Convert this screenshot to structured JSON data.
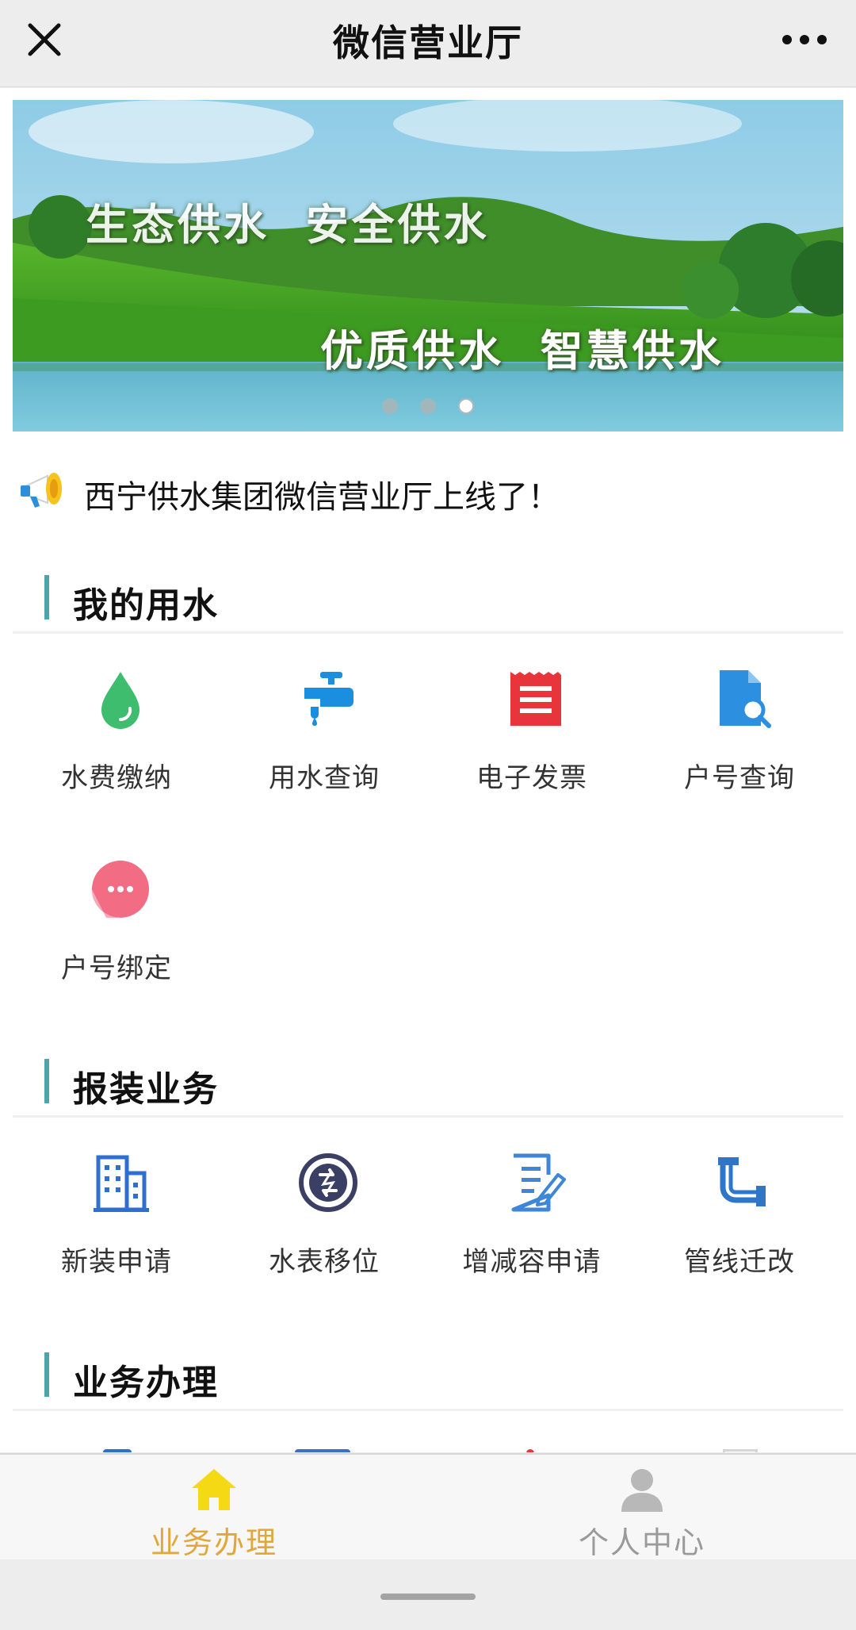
{
  "window": {
    "title": "微信营业厅"
  },
  "banner": {
    "caption_line1": "生态供水  安全供水",
    "caption_line2": "优质供水  智慧供水",
    "slide_count": 3,
    "active_slide": 3
  },
  "notice": {
    "text": "西宁供水集团微信营业厅上线了！",
    "icon": "megaphone-icon"
  },
  "sections": [
    {
      "title": "我的用水",
      "items": [
        {
          "label": "水费缴纳",
          "icon": "water-drop-icon",
          "color": "#3ebd6e"
        },
        {
          "label": "用水查询",
          "icon": "faucet-icon",
          "color": "#1a8fe0"
        },
        {
          "label": "电子发票",
          "icon": "receipt-icon",
          "color": "#e8353b"
        },
        {
          "label": "户号查询",
          "icon": "document-search-icon",
          "color": "#2d8fe0"
        },
        {
          "label": "户号绑定",
          "icon": "chat-bubble-icon",
          "color": "#f26c84"
        }
      ]
    },
    {
      "title": "报装业务",
      "items": [
        {
          "label": "新装申请",
          "icon": "building-icon",
          "color": "#2f6fd0"
        },
        {
          "label": "水表移位",
          "icon": "transfer-icon",
          "color": "#3b3f63"
        },
        {
          "label": "增减容申请",
          "icon": "edit-document-icon",
          "color": "#3d86d8"
        },
        {
          "label": "管线迁改",
          "icon": "pipe-icon",
          "color": "#2f76c8"
        }
      ]
    },
    {
      "title": "业务办理",
      "items": []
    }
  ],
  "tabbar": {
    "tabs": [
      {
        "label": "业务办理",
        "icon": "home-icon",
        "active": true
      },
      {
        "label": "个人中心",
        "icon": "person-icon",
        "active": false
      }
    ],
    "active_color": "#e3a63a",
    "inactive_color": "#9a9a9a"
  },
  "colors": {
    "accent_bar": "#4aa6a8",
    "background": "#ededed"
  }
}
